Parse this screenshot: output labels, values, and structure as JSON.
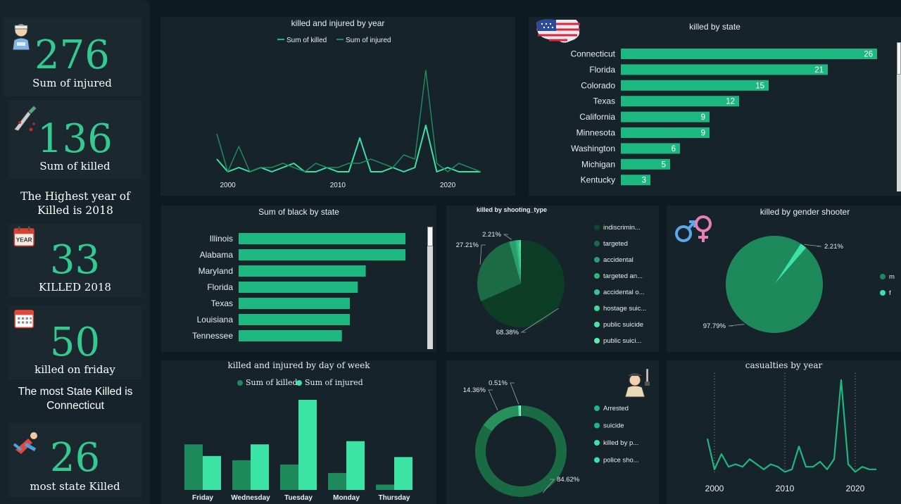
{
  "colors": {
    "green": "#1cb87f",
    "green_light": "#3be3a4",
    "green_dark": "#1e8a5c",
    "pie_dark": "#0d3d26",
    "background": "#0d1a21",
    "panel": "#17232b"
  },
  "kpis": {
    "injured": {
      "value": "276",
      "label": "Sum of injured",
      "icon": "injured-person-icon"
    },
    "killed": {
      "value": "136",
      "label": "Sum of killed",
      "icon": "knife-blood-icon"
    },
    "highest_year": "The Highest year of Killed is 2018",
    "killed_2018": {
      "value": "33",
      "label": "KILLED 2018",
      "icon": "year-calendar-icon"
    },
    "friday": {
      "value": "50",
      "label": "killed on friday",
      "icon": "calendar-icon"
    },
    "most_state": "The most State Killed is Connecticut",
    "state_killed": {
      "value": "26",
      "label": "most state Killed",
      "icon": "falling-person-icon"
    }
  },
  "chart_data": [
    {
      "id": "year_line",
      "type": "line",
      "title": "killed and injured by year",
      "x": [
        1999,
        2000,
        2001,
        2002,
        2003,
        2004,
        2005,
        2006,
        2007,
        2008,
        2009,
        2010,
        2011,
        2012,
        2013,
        2014,
        2015,
        2016,
        2017,
        2018,
        2019,
        2020,
        2021,
        2022,
        2023
      ],
      "series": [
        {
          "name": "Sum of killed",
          "values": [
            4,
            1,
            2,
            1,
            2,
            1,
            2,
            3,
            1,
            1,
            2,
            1,
            1,
            9,
            1,
            1,
            2,
            1,
            2,
            12,
            1,
            2,
            1,
            1,
            1
          ]
        },
        {
          "name": "Sum of injured",
          "values": [
            10,
            1,
            7,
            1,
            2,
            2,
            3,
            2,
            1,
            3,
            2,
            2,
            3,
            3,
            4,
            3,
            2,
            5,
            4,
            25,
            3,
            1,
            3,
            2,
            1
          ]
        }
      ],
      "xticks": [
        "2000",
        "2010",
        "2020"
      ]
    },
    {
      "id": "state_bar",
      "type": "bar",
      "title": "killed by state",
      "categories": [
        "Connecticut",
        "Florida",
        "Colorado",
        "Texas",
        "California",
        "Minnesota",
        "Washington",
        "Michigan",
        "Kentucky"
      ],
      "values": [
        26,
        21,
        15,
        12,
        9,
        9,
        6,
        5,
        3
      ]
    },
    {
      "id": "black_bar",
      "type": "bar",
      "title": "Sum of black by state",
      "categories": [
        "Illinois",
        "Alabama",
        "Maryland",
        "Florida",
        "Texas",
        "Louisiana",
        "Tennessee"
      ],
      "values": [
        21,
        21,
        16,
        15,
        14,
        14,
        13
      ]
    },
    {
      "id": "shooting_pie",
      "type": "pie",
      "title": "killed by shooting_type",
      "labels": [
        "indiscrimin...",
        "targeted",
        "accidental",
        "targeted an...",
        "accidental o...",
        "hostage suic...",
        "public suicide",
        "public suici..."
      ],
      "values": [
        68.38,
        27.21,
        2.21,
        0.7,
        0.5,
        0.4,
        0.3,
        0.29
      ],
      "data_labels": [
        "68.38%",
        "27.21%",
        "2.21%"
      ],
      "colors": [
        "#0d3d26",
        "#1c6a46",
        "#2a9e6c",
        "#35b27a",
        "#3cc789",
        "#44d894",
        "#4be4a0",
        "#58f0ad"
      ]
    },
    {
      "id": "gender_pie",
      "type": "pie",
      "title": "killed by gender shooter",
      "labels": [
        "m",
        "f"
      ],
      "values": [
        97.79,
        2.21
      ],
      "data_labels": [
        "97.79%",
        "2.21%"
      ],
      "colors": [
        "#1e8a5c",
        "#3be3a4"
      ]
    },
    {
      "id": "day_bar",
      "type": "bar",
      "title": "killed and injured by day of week",
      "categories": [
        "Friday",
        "Wednesday",
        "Tuesday",
        "Monday",
        "Thursday"
      ],
      "series": [
        {
          "name": "Sum of killed",
          "values": [
            43,
            28,
            24,
            16,
            5
          ]
        },
        {
          "name": "Sum of injured",
          "values": [
            32,
            43,
            85,
            46,
            31
          ]
        }
      ]
    },
    {
      "id": "outcome_donut",
      "type": "pie",
      "labels": [
        "Arrested",
        "suicide",
        "killed by p...",
        "police sho..."
      ],
      "values": [
        84.62,
        14.36,
        0.51,
        0.51
      ],
      "data_labels": [
        "84.62%",
        "14.36%",
        "0.51%"
      ],
      "colors": [
        "#1a6b43",
        "#27915d",
        "#3be3a4",
        "#9ef5cf"
      ]
    },
    {
      "id": "casualties_line",
      "type": "line",
      "title": "casualties by year",
      "x": [
        1999,
        2000,
        2001,
        2002,
        2003,
        2004,
        2005,
        2006,
        2007,
        2008,
        2009,
        2010,
        2011,
        2012,
        2013,
        2014,
        2015,
        2016,
        2017,
        2018,
        2019,
        2020,
        2021,
        2022,
        2023
      ],
      "series": [
        {
          "values": [
            14,
            2,
            8,
            3,
            4,
            3,
            6,
            4,
            2,
            4,
            3,
            1,
            2,
            11,
            3,
            3,
            5,
            2,
            6,
            37,
            4,
            1,
            3,
            2,
            2
          ]
        }
      ],
      "xticks": [
        "2000",
        "2010",
        "2020"
      ]
    }
  ]
}
